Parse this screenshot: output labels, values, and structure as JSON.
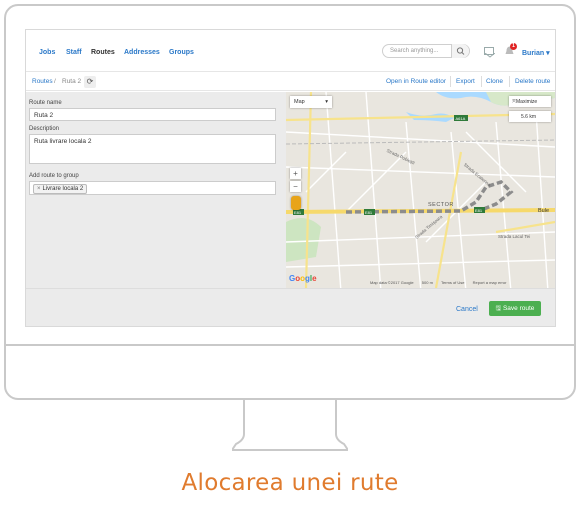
{
  "nav": {
    "items": [
      "Jobs",
      "Staff",
      "Routes",
      "Addresses",
      "Groups"
    ],
    "search_placeholder": "Search anything...",
    "user": "Burian",
    "notification_count": "1"
  },
  "breadcrumb": {
    "root": "Routes",
    "current": "Ruta 2"
  },
  "actions": {
    "open_editor": "Open in Route editor",
    "export": "Export",
    "clone": "Clone",
    "delete": "Delete route"
  },
  "form": {
    "route_name_label": "Route name",
    "route_name_value": "Ruta 2",
    "description_label": "Description",
    "description_value": "Ruta livrare locala 2",
    "group_label": "Add route to group",
    "group_tag": "Livrare locala 2"
  },
  "map": {
    "type_label": "Map",
    "maximize_label": "Maximize",
    "distance": "5.6 km",
    "sector_label": "SECTOR",
    "footer_data": "Map data ©2017 Google",
    "footer_scale": "500 m",
    "footer_terms": "Terms of Use",
    "footer_report": "Report a map error",
    "road_label_1": "Strada Pobiești",
    "road_label_2": "Strada Ecaterina",
    "road_label_3": "Strada Timișoara",
    "road_label_4": "Strada Lacul Tei",
    "shield_1": "A61A",
    "shield_2": "E81",
    "shield_3": "E81",
    "shield_4": "E81",
    "ble_label": "Bule"
  },
  "footer": {
    "cancel_label": "Cancel",
    "save_label": "Save route"
  },
  "caption": "Alocarea unei rute",
  "colors": {
    "accent": "#2a78c8",
    "save": "#4caf50",
    "caption": "#e07b2e",
    "badge": "#e02424"
  }
}
